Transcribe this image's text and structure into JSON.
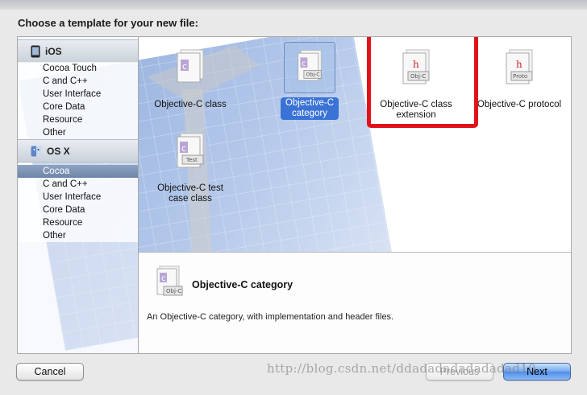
{
  "sheet": {
    "title": "Choose a template for your new file:"
  },
  "sidebar": {
    "ios": {
      "header": "iOS",
      "items": [
        "Cocoa Touch",
        "C and C++",
        "User Interface",
        "Core Data",
        "Resource",
        "Other"
      ]
    },
    "osx": {
      "header": "OS X",
      "items": [
        "Cocoa",
        "C and C++",
        "User Interface",
        "Core Data",
        "Resource",
        "Other"
      ],
      "selected": "Cocoa"
    }
  },
  "templates": [
    {
      "label_1": "Objective-C class",
      "label_2": "",
      "badge": ""
    },
    {
      "label_1": "Objective-C",
      "label_2": "category",
      "badge": "Obj-C"
    },
    {
      "label_1": "Objective-C class",
      "label_2": "extension",
      "badge": "Obj-C"
    },
    {
      "label_1": "Objective-C protocol",
      "label_2": "",
      "badge": "Proto"
    },
    {
      "label_1": "Objective-C test",
      "label_2": "case class",
      "badge": "Test"
    }
  ],
  "selected_template": "Objective-C category",
  "detail": {
    "title": "Objective-C category",
    "description": "An Objective-C category, with implementation and header files.",
    "badge": "Obj-C"
  },
  "buttons": {
    "cancel": "Cancel",
    "previous": "Previous",
    "next": "Next"
  },
  "watermark": "http://blog.csdn.net/ddadadadadadadad10",
  "colors": {
    "highlight": "#e0131a",
    "selection": "#3a72d6",
    "primary_button": "#5b97ea"
  },
  "icons": [
    "ios-device-icon",
    "osx-finder-icon",
    "objc-file-icon",
    "header-file-icon"
  ]
}
